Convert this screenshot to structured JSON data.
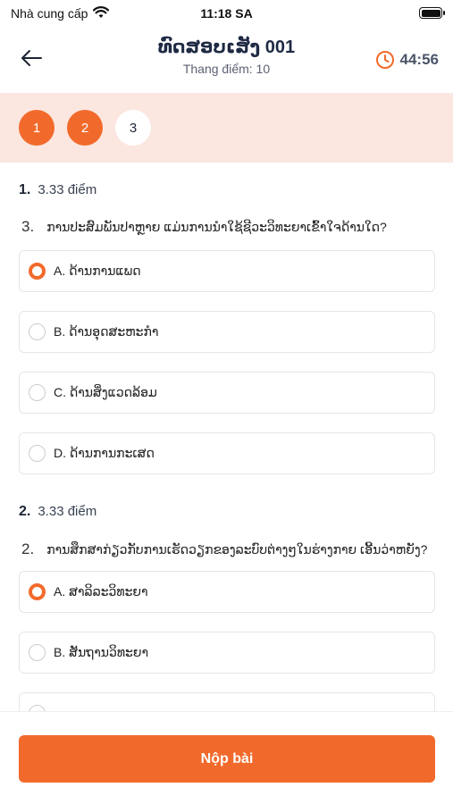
{
  "status_bar": {
    "carrier": "Nhà cung cấp",
    "time": "11:18 SA"
  },
  "header": {
    "title": "ທົດສອບເສັງ 001",
    "subtitle": "Thang điểm: 10",
    "timer": "44:56"
  },
  "question_nav": [
    "1",
    "2",
    "3"
  ],
  "questions": [
    {
      "index": "1.",
      "score": "3.33 điểm",
      "number": "3.",
      "text": "ການປະສົມພັນປາຫຼາຍ ແມ່ນການນຳໃຊ້ຊີວະວິທະຍາເຂົ້າໃຈດ້ານໃດ?",
      "options": [
        {
          "label": "A. ດ້ານການແພດ",
          "selected": true
        },
        {
          "label": "B. ດ້ານອຸດສະຫະກຳ",
          "selected": false
        },
        {
          "label": "C. ດ້ານສິ່ງແວດລ້ອມ",
          "selected": false
        },
        {
          "label": "D. ດ້ານການກະເສດ",
          "selected": false
        }
      ]
    },
    {
      "index": "2.",
      "score": "3.33 điểm",
      "number": "2.",
      "text": "ການສຶກສາກ່ຽວກັບການເຮັດວຽກຂອງລະບົບຕ່າງໆໃນຮ່າງກາຍ ເອີ້ນວ່າຫຍັງ?",
      "options": [
        {
          "label": "A. ສາລິລະວິທະຍາ",
          "selected": true
        },
        {
          "label": "B. ສັນຖານວິທະຍາ",
          "selected": false
        },
        {
          "label": "",
          "selected": false
        }
      ]
    }
  ],
  "submit_label": "Nộp bài",
  "colors": {
    "accent": "#f26a2b",
    "nav_background": "#fce6e0",
    "text_dark": "#1c2434"
  }
}
